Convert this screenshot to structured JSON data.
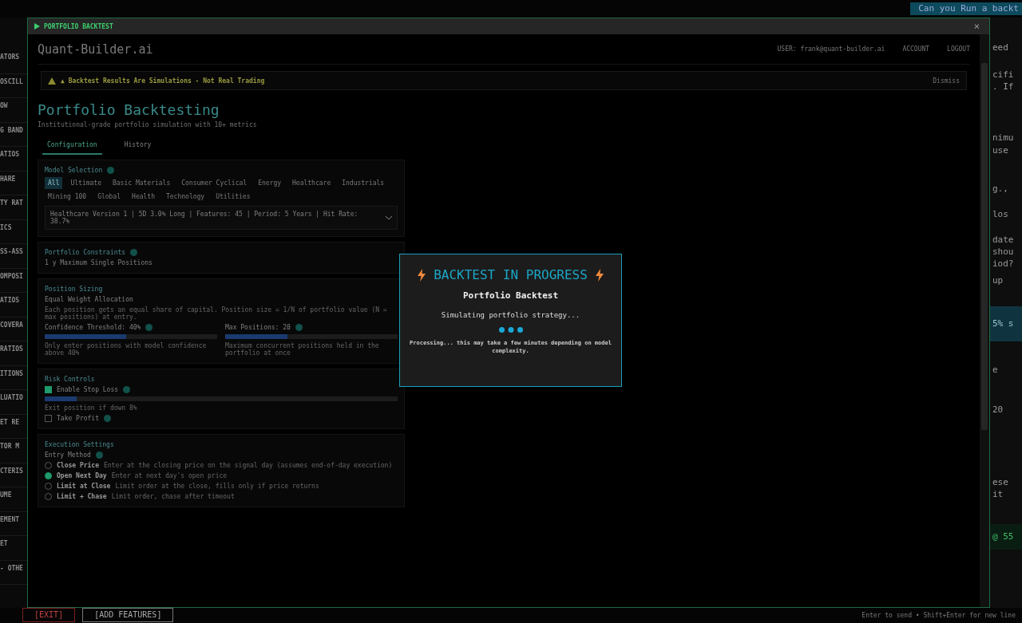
{
  "sidebar": {
    "items": [
      "ATORS",
      "OSCILL",
      "OW",
      "G BAND",
      "ATIOS",
      "HARE",
      "TY RAT",
      "ICS",
      "SS-ASS",
      "OMPOSI",
      "ATIOS",
      "COVERA",
      "RATIOS",
      "ITIONS",
      "LUATIO",
      "ET RE",
      "TOR M",
      "CTERIS",
      "UME",
      "EMENT",
      "ET",
      "- OTHE"
    ]
  },
  "chat": {
    "prompt": "Can you Run a backt",
    "lines": [
      {
        "text": "eed",
        "kind": "plain"
      },
      {
        "text": "cifi",
        "kind": "plain"
      },
      {
        "text": ". If",
        "kind": "plain"
      },
      {
        "text": "nimu",
        "kind": "plain"
      },
      {
        "text": "use",
        "kind": "plain"
      },
      {
        "text": "g.,",
        "kind": "plain"
      },
      {
        "text": "los",
        "kind": "plain"
      },
      {
        "text": "date",
        "kind": "plain"
      },
      {
        "text": "shou",
        "kind": "plain"
      },
      {
        "text": "iod?",
        "kind": "plain"
      },
      {
        "text": "up",
        "kind": "plain"
      },
      {
        "text": "5% s",
        "kind": "highlight"
      },
      {
        "text": "e",
        "kind": "plain"
      },
      {
        "text": "20",
        "kind": "plain"
      },
      {
        "text": "ese",
        "kind": "plain"
      },
      {
        "text": "it",
        "kind": "plain"
      },
      {
        "text": "@ 55",
        "kind": "success"
      }
    ],
    "hint": "Enter to send • Shift+Enter for new line"
  },
  "footer": {
    "buttons": [
      {
        "label": "[EXIT]",
        "kind": "danger"
      },
      {
        "label": "[ADD FEATURES]",
        "kind": "normal"
      }
    ]
  },
  "window": {
    "title": "PORTFOLIO BACKTEST",
    "close": "×"
  },
  "app": {
    "brand": "Quant-Builder.ai",
    "user": "USER: frank@quant-builder.ai",
    "nav": [
      "ACCOUNT",
      "LOGOUT"
    ],
    "warning": "▲ Backtest Results Are Simulations - Not Real Trading",
    "dismiss": "Dismiss",
    "heading": "Portfolio Backtesting",
    "subheading": "Institutional-grade portfolio simulation with 10+ metrics",
    "tabs": [
      {
        "label": "Configuration",
        "selected": true
      },
      {
        "label": "History",
        "selected": false
      }
    ],
    "model": {
      "title": "Model Selection",
      "chips": [
        {
          "label": "All",
          "selected": true
        },
        {
          "label": "Ultimate",
          "selected": false
        },
        {
          "label": "Basic Materials",
          "selected": false
        },
        {
          "label": "Consumer Cyclical",
          "selected": false
        },
        {
          "label": "Energy",
          "selected": false
        },
        {
          "label": "Healthcare",
          "selected": false
        },
        {
          "label": "Industrials",
          "selected": false
        },
        {
          "label": "Mining 100",
          "selected": false
        },
        {
          "label": "Global",
          "selected": false
        },
        {
          "label": "Health",
          "selected": false
        },
        {
          "label": "Technology",
          "selected": false
        },
        {
          "label": "Utilities",
          "selected": false
        }
      ],
      "dropdown": "Healthcare Version 1 | 5D 3.0% Long | Features: 45 | Period: 5 Years | Hit Rate: 38.7%"
    },
    "constraints": {
      "title": "Portfolio Constraints",
      "row": "1 y  Maximum Single Positions"
    },
    "sizing": {
      "title": "Position Sizing",
      "method": "Equal Weight Allocation",
      "note": "Each position gets an equal share of capital. Position size = 1/N of portfolio value (N = max positions) at entry.",
      "sliders": [
        {
          "label": "Confidence Threshold: 40%",
          "level": 0.47,
          "caption": "Only enter positions with model confidence above 40%"
        },
        {
          "label": "Max Positions: 20",
          "level": 0.36,
          "caption": "Maximum concurrent positions held in the portfolio at once"
        }
      ]
    },
    "risk": {
      "title": "Risk Controls",
      "stop_loss": {
        "label": "Enable Stop Loss",
        "checked": true,
        "level": 0.09,
        "caption": "Exit position if down 8%"
      },
      "take_profit": {
        "label": "Take Profit",
        "checked": false
      }
    },
    "execution": {
      "title": "Execution Settings",
      "label": "Entry Method",
      "options": [
        {
          "label": "Close Price",
          "desc": "Enter at the closing price on the signal day (assumes end-of-day execution)",
          "selected": false
        },
        {
          "label": "Open Next Day",
          "desc": "Enter at next day's open price",
          "selected": true
        },
        {
          "label": "Limit at Close",
          "desc": "Limit order at the close, fills only if price returns",
          "selected": false
        },
        {
          "label": "Limit + Chase",
          "desc": "Limit order, chase after timeout",
          "selected": false
        }
      ]
    }
  },
  "modal": {
    "title": "BACKTEST IN PROGRESS",
    "subtitle": "Portfolio Backtest",
    "status": "Simulating portfolio strategy...",
    "note": "Processing... this may take a few minutes depending on model complexity."
  }
}
